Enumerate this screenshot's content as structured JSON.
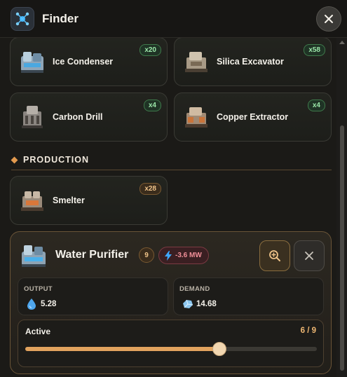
{
  "window": {
    "title": "Finder"
  },
  "items": [
    {
      "name": "Ice Condenser",
      "count": "x20",
      "badge": "green"
    },
    {
      "name": "Silica Excavator",
      "count": "x58",
      "badge": "green"
    },
    {
      "name": "Carbon Drill",
      "count": "x4",
      "badge": "green"
    },
    {
      "name": "Copper Extractor",
      "count": "x4",
      "badge": "green"
    }
  ],
  "section": {
    "title": "PRODUCTION"
  },
  "production_items": [
    {
      "name": "Smelter",
      "count": "x28",
      "badge": "orange"
    }
  ],
  "selected": {
    "name": "Water Purifier",
    "level": "9",
    "power": "-3.6 MW",
    "output": {
      "label": "OUTPUT",
      "value": "5.28",
      "icon": "water-drop-icon"
    },
    "demand": {
      "label": "DEMAND",
      "value": "14.68",
      "icon": "ice-crystal-icon"
    },
    "active": {
      "label": "Active",
      "text": "6 / 9",
      "current": 6,
      "max": 9
    }
  },
  "icons": {
    "app": "network-node-icon",
    "close": "close-icon",
    "find": "search-zoom-icon",
    "remove": "close-icon",
    "power": "lightning-icon"
  },
  "colors": {
    "accent": "#e2a35e",
    "badge_green": "#9be7a9",
    "badge_orange": "#f0c48a",
    "power_negative": "#f08f98"
  }
}
